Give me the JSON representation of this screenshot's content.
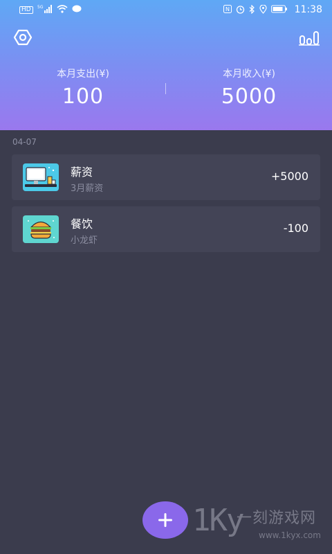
{
  "status_bar": {
    "left_icons": [
      "hd-icon",
      "signal-5g-icon",
      "wifi-icon",
      "chat-icon"
    ],
    "right_icons": [
      "nfc-icon",
      "alarm-icon",
      "bluetooth-icon",
      "location-icon",
      "battery-icon"
    ],
    "time": "11:38",
    "hd_label": "HD",
    "network_label": "5G"
  },
  "header": {
    "settings_icon": "gear-icon",
    "stats_icon": "bar-chart-icon",
    "expense_label": "本月支出(¥)",
    "expense_value": "100",
    "income_label": "本月收入(¥)",
    "income_value": "5000",
    "colors": {
      "gradient_top": "#5fa8f5",
      "gradient_bottom": "#9a78ee"
    }
  },
  "records": {
    "date": "04-07",
    "items": [
      {
        "title": "薪资",
        "subtitle": "3月薪资",
        "amount": "+5000",
        "icon": "salary-computer-icon"
      },
      {
        "title": "餐饮",
        "subtitle": "小龙虾",
        "amount": "-100",
        "icon": "burger-icon"
      }
    ]
  },
  "fab": {
    "label": "+",
    "icon": "plus-icon",
    "color": "#8a68ea"
  },
  "watermark": {
    "logo": "1Ky",
    "brand": "一刻游戏网",
    "url": "www.1kyx.com"
  }
}
